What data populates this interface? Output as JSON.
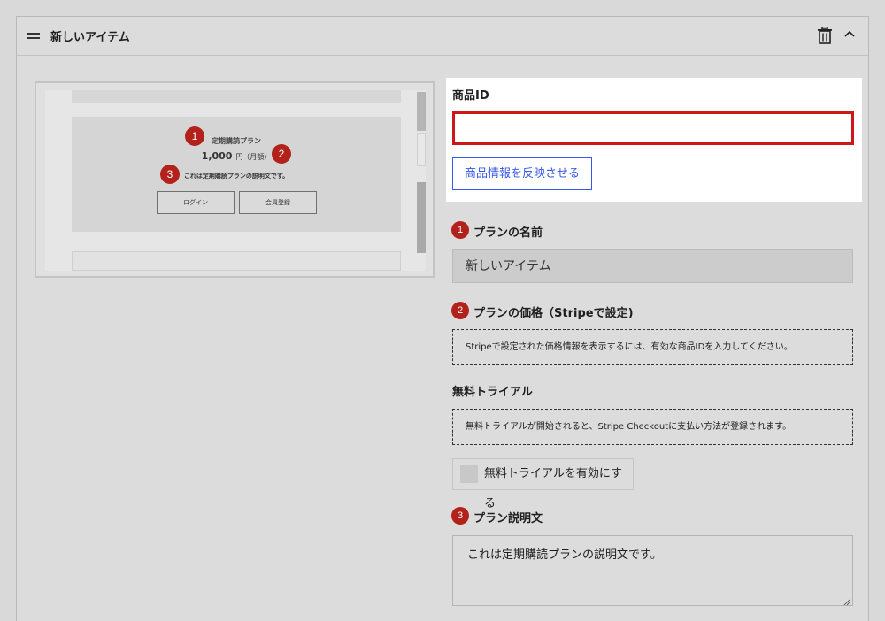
{
  "header": {
    "title": "新しいアイテム"
  },
  "preview": {
    "plan_name": "定期購読プラン",
    "price": "1,000",
    "price_unit": "円（月額）",
    "description": "これは定期購読プランの説明文です。",
    "login_label": "ログイン",
    "register_label": "会員登録",
    "badges": [
      "1",
      "2",
      "3"
    ]
  },
  "sku": {
    "label": "商品ID",
    "value": "",
    "reflect_button": "商品情報を反映させる"
  },
  "plan_name_field": {
    "badge": "1",
    "label": "プランの名前",
    "value": "新しいアイテム"
  },
  "plan_price_field": {
    "badge": "2",
    "label": "プランの価格（Stripeで設定)",
    "notice": "Stripeで設定された価格情報を表示するには、有効な商品IDを入力してください。"
  },
  "trial": {
    "label": "無料トライアル",
    "notice": "無料トライアルが開始されると、Stripe Checkoutに支払い方法が登録されます。",
    "toggle_label": "無料トライアルを有効にする"
  },
  "plan_desc_field": {
    "badge": "3",
    "label": "プラン説明文",
    "value": "これは定期購読プランの説明文です。"
  },
  "colors": {
    "badge": "#b3211b",
    "error_border": "#cc1818",
    "accent": "#3858e9"
  }
}
